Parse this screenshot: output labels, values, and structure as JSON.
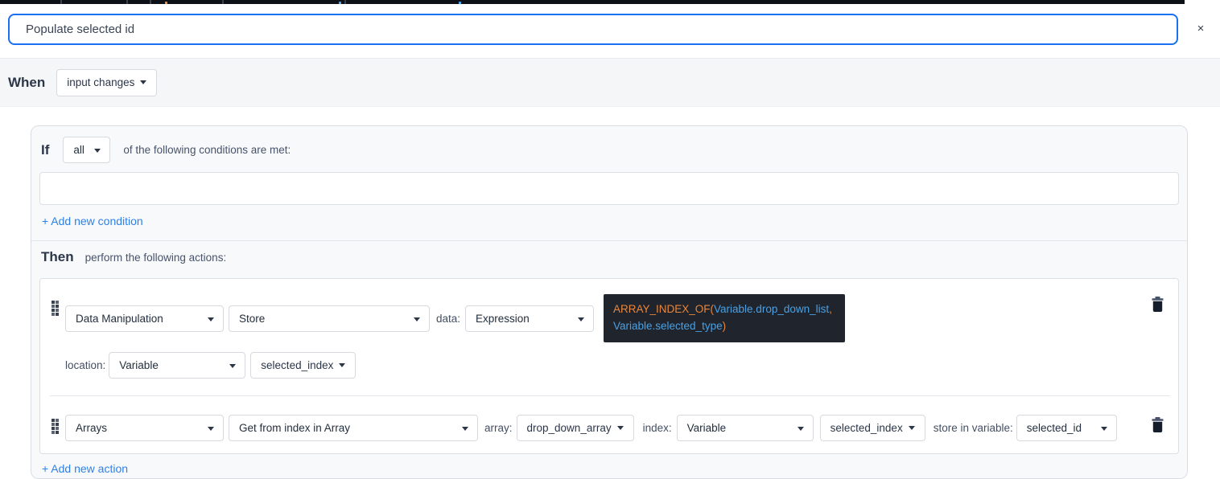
{
  "colors": {
    "accent_blue": "#1a6ff2",
    "link_blue": "#2e81e9",
    "code_bg": "#20242d",
    "code_orange": "#e8873d",
    "code_blue": "#4aa0e2"
  },
  "header": {
    "title_value": "Populate selected id",
    "close_label": "×"
  },
  "when": {
    "label": "When",
    "event_dropdown": "input changes"
  },
  "rule": {
    "if": {
      "label": "If",
      "match_dropdown": "all",
      "suffix": "of the following conditions are met:"
    },
    "add_condition_label": "+ Add new condition",
    "then": {
      "label": "Then",
      "suffix": "perform the following actions:"
    },
    "actions": [
      {
        "category": "Data Manipulation",
        "operation": "Store",
        "data_label": "data:",
        "data_type": "Expression",
        "expression": {
          "fn": "ARRAY_INDEX_OF(",
          "arg1": "Variable.drop_down_list",
          "comma": ",",
          "arg2": "Variable.selected_type",
          "close": ")"
        },
        "location_label": "location:",
        "location_type": "Variable",
        "location_var": "selected_index"
      },
      {
        "category": "Arrays",
        "operation": "Get from index in Array",
        "array_label": "array:",
        "array_value": "drop_down_array",
        "index_label": "index:",
        "index_type": "Variable",
        "index_var": "selected_index",
        "store_label": "store in variable:",
        "store_var": "selected_id"
      }
    ],
    "add_action_label": "+ Add new action"
  }
}
